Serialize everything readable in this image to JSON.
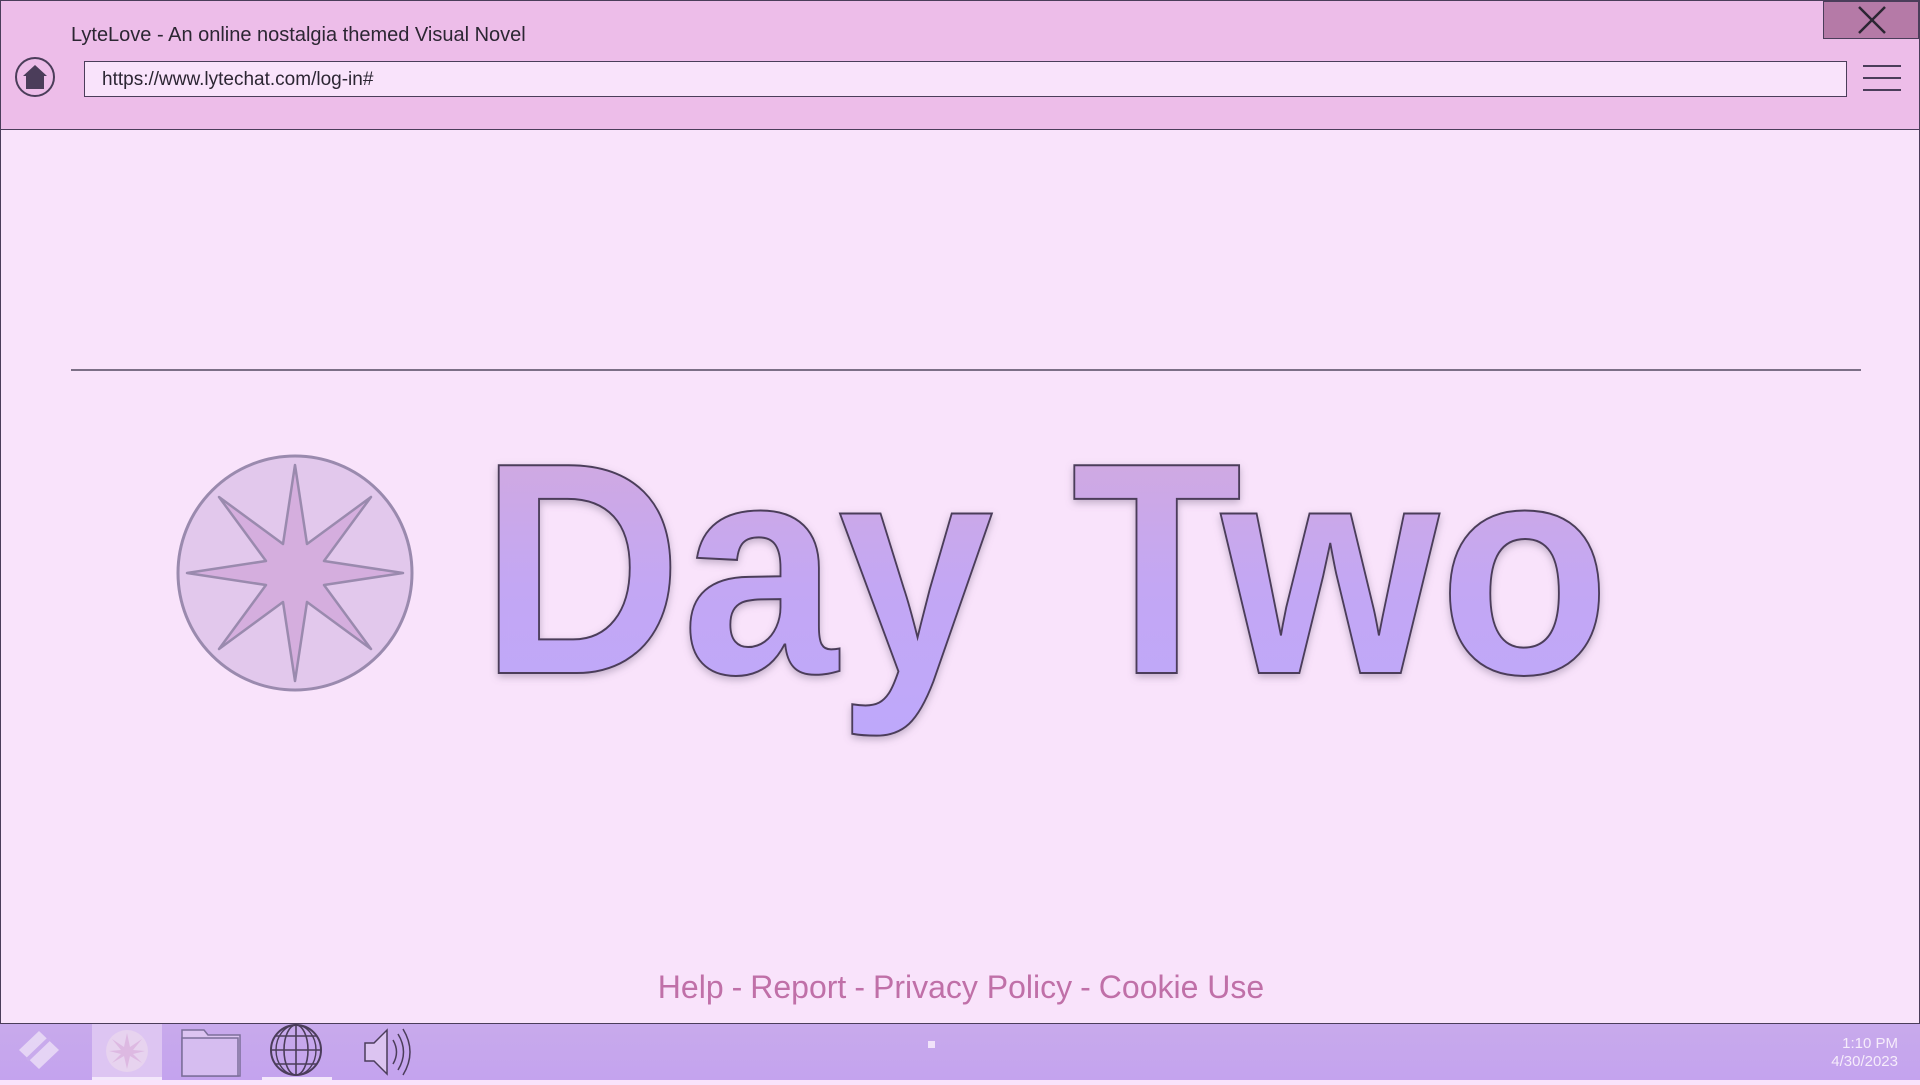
{
  "window": {
    "title": "LyteLove - An online nostalgia themed Visual Novel",
    "url": "https://www.lytechat.com/log-in#"
  },
  "main": {
    "heading": "Day Two",
    "emblem_icon": "eight-point-star-icon"
  },
  "footer": {
    "links": [
      "Help",
      "Report",
      "Privacy Policy",
      "Cookie Use"
    ],
    "separator": "-"
  },
  "taskbar": {
    "items": [
      "diamond-logo-icon",
      "star-app-icon",
      "folder-icon",
      "globe-icon",
      "speaker-icon"
    ],
    "time": "1:10 PM",
    "date": "4/30/2023"
  },
  "colors": {
    "background": "#f9e3fb",
    "titlebar": "#edbde9",
    "close_button": "#b57aa7",
    "heading_gradient_top": "#d3a9dc",
    "heading_gradient_bottom": "#bea8fb",
    "footer_link": "#c070a8",
    "taskbar": "#c6a7ed"
  }
}
